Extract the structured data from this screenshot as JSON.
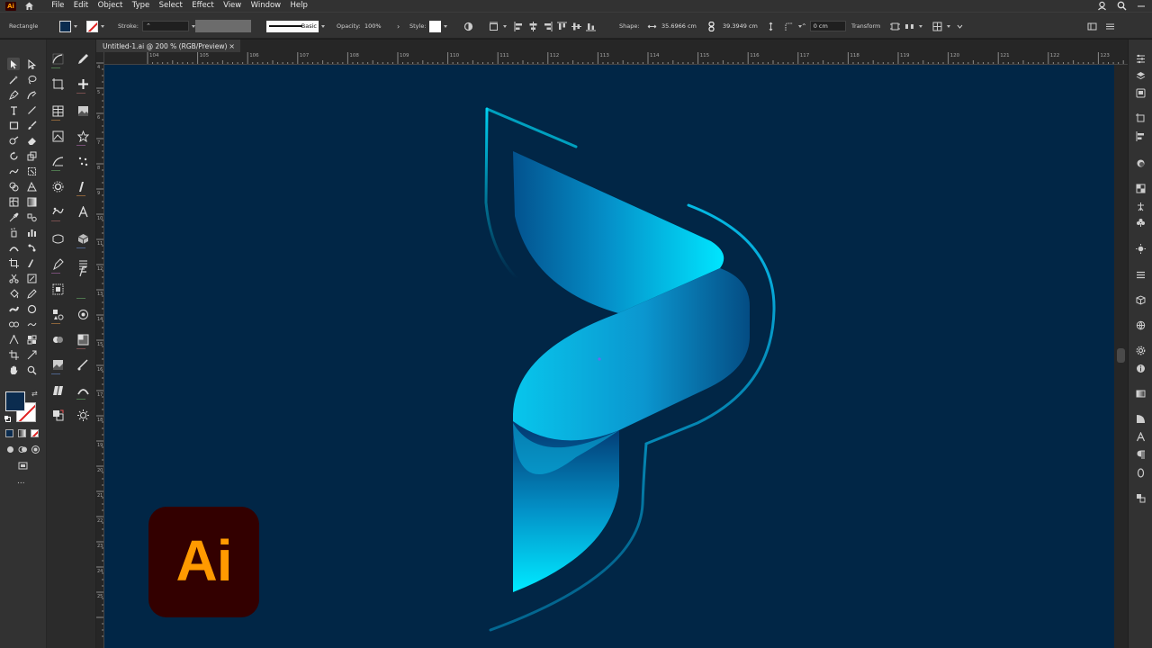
{
  "menubar": {
    "app_badge": "Ai",
    "items": [
      "File",
      "Edit",
      "Object",
      "Type",
      "Select",
      "Effect",
      "View",
      "Window",
      "Help"
    ]
  },
  "controlbar": {
    "selection_label": "Rectangle",
    "stroke_label": "Stroke:",
    "brush_label": "Basic",
    "opacity_label": "Opacity:",
    "opacity_value": "100%",
    "style_label": "Style:",
    "shape_label": "Shape:",
    "width_value": "35.6966 cm",
    "height_value": "39.3949 cm",
    "corner_value": "0 cm",
    "transform_label": "Transform"
  },
  "document": {
    "tab_title": "Untitled-1.ai @ 200 % (RGB/Preview)",
    "close_glyph": "×"
  },
  "ruler": {
    "h_labels": [
      "104",
      "105",
      "106",
      "107",
      "108",
      "109",
      "110",
      "111",
      "112",
      "113",
      "114",
      "115",
      "116",
      "117",
      "118",
      "119",
      "120",
      "121",
      "122",
      "123"
    ],
    "v_labels": [
      "4",
      "5",
      "6",
      "7",
      "8",
      "9",
      "10",
      "11",
      "12",
      "13",
      "14",
      "15",
      "16",
      "17",
      "18",
      "19",
      "20",
      "21",
      "22",
      "23",
      "24",
      "25"
    ]
  },
  "logo": {
    "text": "Ai",
    "bg": "#330000",
    "fg": "#ff9a00"
  },
  "colors": {
    "canvas": "#012646",
    "accent_cyan": "#00e5ff",
    "deep_blue": "#05497e"
  },
  "toolbar": {
    "more_glyph": "..."
  }
}
